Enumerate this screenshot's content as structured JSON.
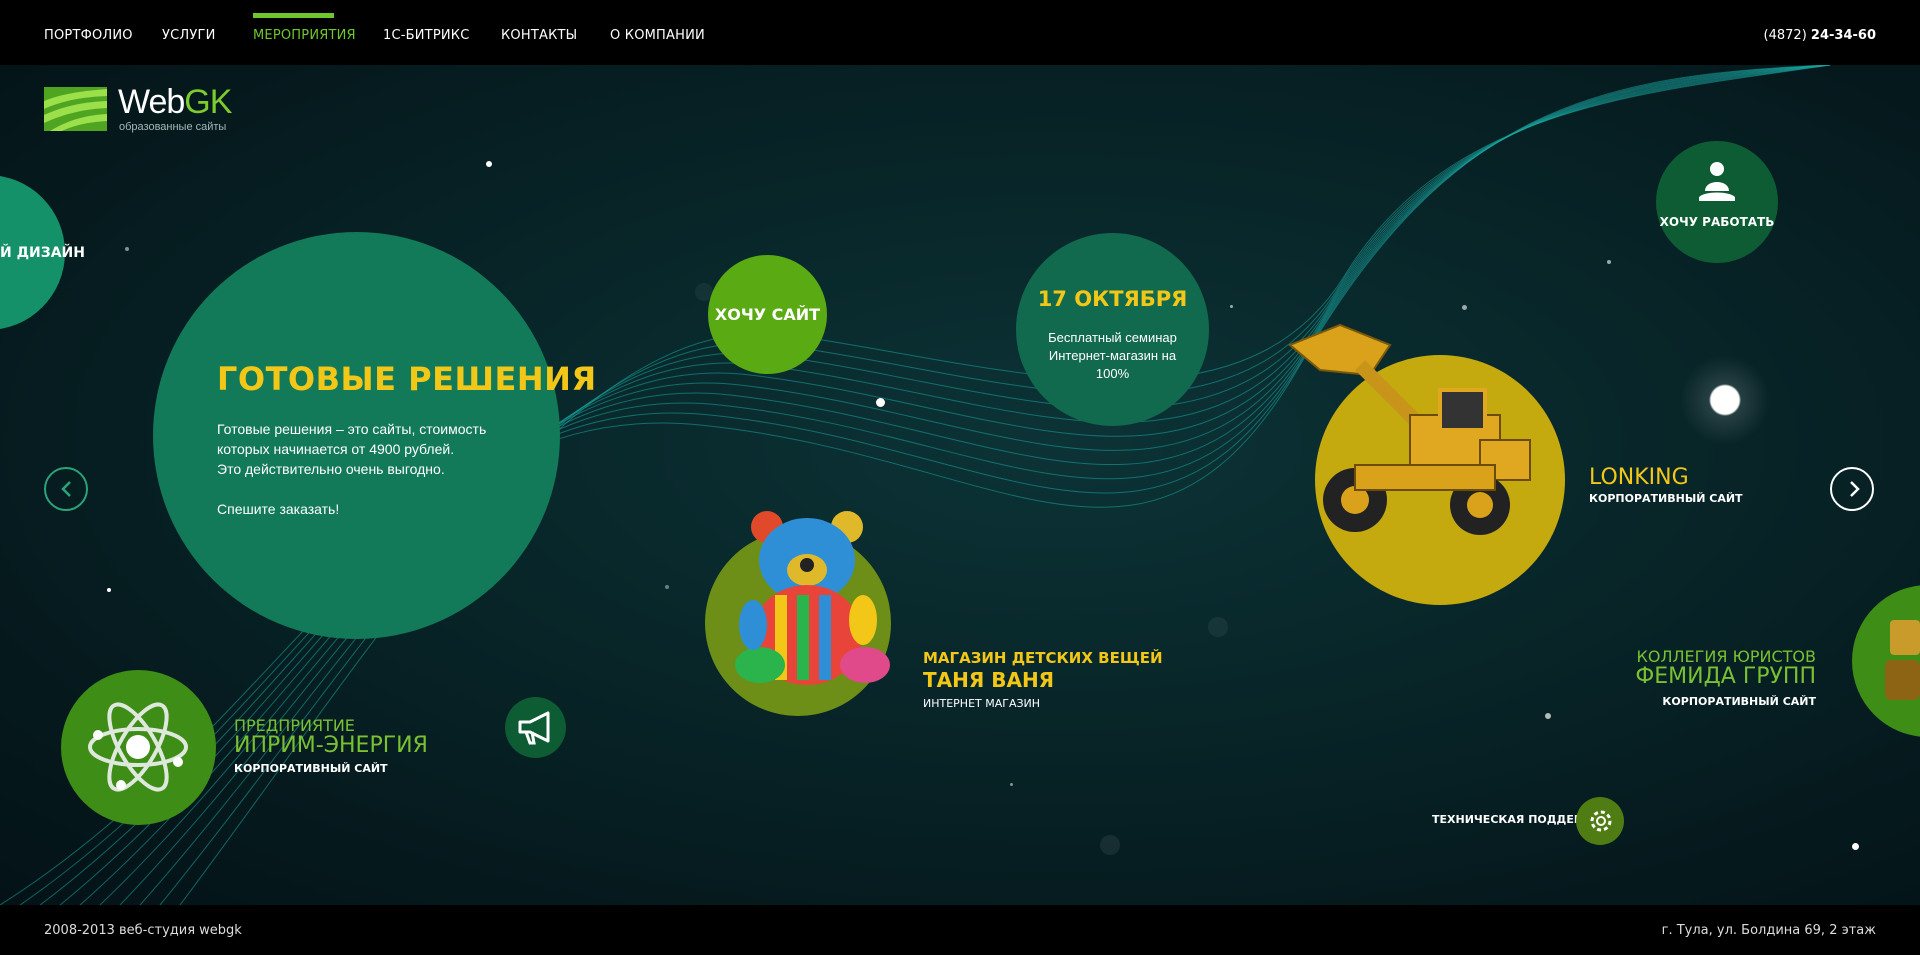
{
  "nav": {
    "items": [
      {
        "label": "ПОРТФОЛИО"
      },
      {
        "label": "УСЛУГИ"
      },
      {
        "label": "МЕРОПРИЯТИЯ"
      },
      {
        "label": "1С-БИТРИКС"
      },
      {
        "label": "КОНТАКТЫ"
      },
      {
        "label": "О КОМПАНИИ"
      }
    ],
    "active": "МЕРОПРИЯТИЯ",
    "phone_code": "(4872)",
    "phone_number": "24-34-60"
  },
  "logo": {
    "name_web": "Web",
    "name_gk": "GK",
    "tagline": "образованные сайты"
  },
  "left_partial": {
    "label": "Й ДИЗАЙН"
  },
  "solutions": {
    "title": "ГОТОВЫЕ РЕШЕНИЯ",
    "line1": "Готовые решения – это сайты, стоимость",
    "line2": "которых начинается от 4900 рублей.",
    "line3": "Это действительно очень выгодно.",
    "cta": "Спешите заказать!"
  },
  "want_site": {
    "label": "ХОЧУ САЙТ"
  },
  "event": {
    "date": "17 ОКТЯБРЯ",
    "line1": "Бесплатный семинар",
    "line2": "Интернет-магазин на",
    "line3": "100%"
  },
  "want_work": {
    "label": "ХОЧУ РАБОТАТЬ"
  },
  "lonking": {
    "title": "LONKING",
    "subtitle": "КОРПОРАТИВНЫЙ САЙТ"
  },
  "tanya": {
    "line1": "МАГАЗИН ДЕТСКИХ ВЕЩЕЙ",
    "line2": "ТАНЯ ВАНЯ",
    "subtitle": "ИНТЕРНЕТ МАГАЗИН"
  },
  "iprim": {
    "line1": "ПРЕДПРИЯТИЕ",
    "line2": "ИПРИМ-ЭНЕРГИЯ",
    "subtitle": "КОРПОРАТИВНЫЙ САЙТ"
  },
  "femida": {
    "line1": "КОЛЛЕГИЯ ЮРИСТОВ",
    "line2": "ФЕМИДА ГРУПП",
    "subtitle": "КОРПОРАТИВНЫЙ САЙТ"
  },
  "support": {
    "label": "ТЕХНИЧЕСКАЯ ПОДДЕРЖКА"
  },
  "footer": {
    "copyright": "2008-2013 веб-студия webgk",
    "address": "г. Тула, ул. Болдина 69, 2 этаж"
  },
  "colors": {
    "accent_green": "#6ec72d",
    "teal_circle": "#127a58",
    "yellow_text": "#f2c718",
    "mustard_circle": "#c4a90f",
    "olive_circle": "#6d8f17"
  },
  "icons": [
    "person-icon",
    "gear-icon",
    "megaphone-icon",
    "atom-icon",
    "chevron-left-icon",
    "chevron-right-icon"
  ]
}
